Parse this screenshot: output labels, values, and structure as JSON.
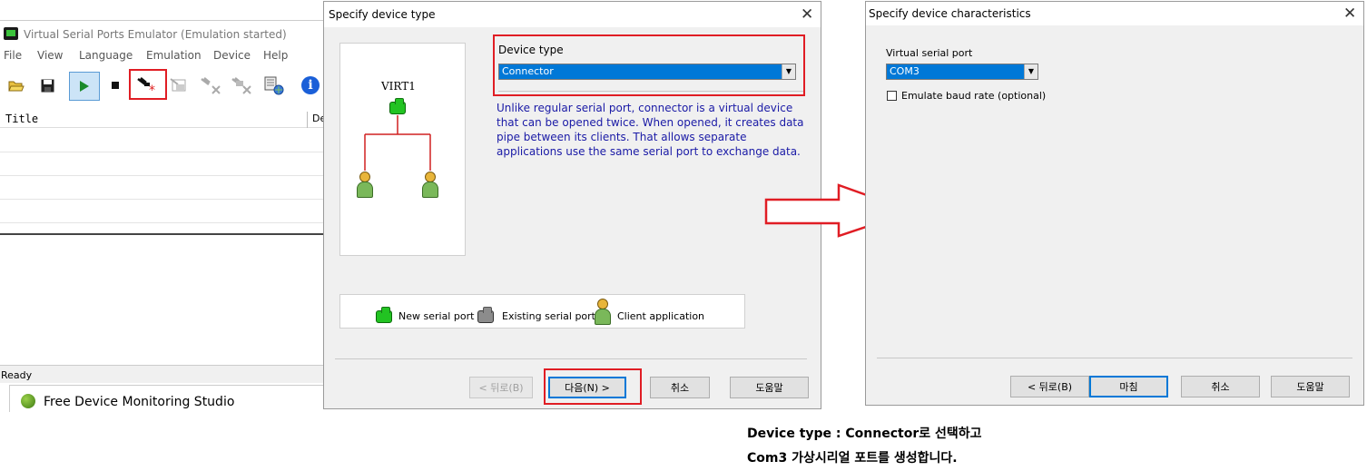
{
  "main_window": {
    "title": "Virtual Serial Ports Emulator (Emulation started)",
    "menu": [
      "File",
      "View",
      "Language",
      "Emulation",
      "Device",
      "Help"
    ],
    "list_header_title": "Title",
    "list_header_second": "De",
    "status": "Ready",
    "taskbar_item": "Free Device Monitoring Studio",
    "toolbar_icons": [
      "open-folder-icon",
      "save-icon",
      "play-icon",
      "stop-icon",
      "new-device-icon",
      "device-properties-icon",
      "delete-device-icon",
      "remove-device-icon",
      "network-icon",
      "info-icon"
    ]
  },
  "dialog1": {
    "title": "Specify device type",
    "diagram_label": "VIRT1",
    "device_type_label": "Device type",
    "device_type_value": "Connector",
    "description": "Unlike regular serial port, connector is a virtual device that can be opened twice. When opened, it creates data pipe between its clients. That allows separate applications use the same serial port to exchange data.",
    "legend": {
      "new_port": "New serial port",
      "existing_port": "Existing serial port",
      "client_app": "Client application"
    },
    "buttons": {
      "back": "< 뒤로(B)",
      "next": "다음(N) >",
      "cancel": "취소",
      "help": "도움말"
    }
  },
  "dialog2": {
    "title": "Specify device characteristics",
    "virtual_port_label": "Virtual serial port",
    "virtual_port_value": "COM3",
    "emulate_baud_label": "Emulate baud rate (optional)",
    "buttons": {
      "back": "< 뒤로(B)",
      "finish": "마침",
      "cancel": "취소",
      "help": "도움말"
    }
  },
  "caption": {
    "line1": "Device type : Connector로 선택하고",
    "line2": "Com3 가상시리얼 포트를 생성합니다."
  },
  "colors": {
    "highlight": "#e01d24",
    "selection": "#0078d7",
    "description_text": "#1a1aa6",
    "port_new": "#22c322",
    "port_existing": "#8c8c8c"
  }
}
